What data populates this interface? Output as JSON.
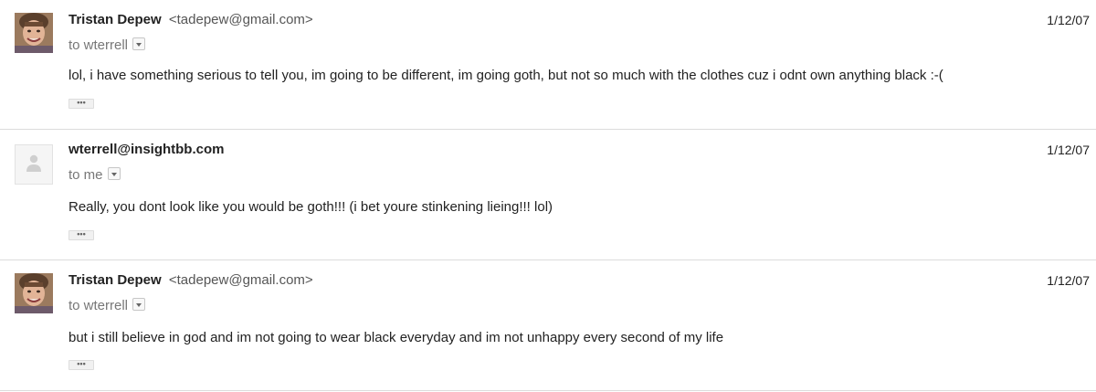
{
  "messages": [
    {
      "sender_name": "Tristan Depew",
      "sender_email": "<tadepew@gmail.com>",
      "recipient": "to wterrell",
      "date": "1/12/07",
      "body": "lol, i have something serious to tell you, im going to be different, im going goth, but not so much with the clothes cuz i odnt own anything black :-(",
      "trimmed_label": "•••",
      "avatar": "profile-photo"
    },
    {
      "sender_name": "wterrell@insightbb.com",
      "sender_email": "",
      "recipient": "to me",
      "date": "1/12/07",
      "body": "Really, you dont look like you would be goth!!! (i bet youre stinkening lieing!!! lol)",
      "trimmed_label": "•••",
      "avatar": "default-person-icon"
    },
    {
      "sender_name": "Tristan Depew",
      "sender_email": "<tadepew@gmail.com>",
      "recipient": "to wterrell",
      "date": "1/12/07",
      "body": "but i still believe in god and im not going to wear black everyday and im not unhappy every second of my life",
      "trimmed_label": "•••",
      "avatar": "profile-photo"
    }
  ],
  "colors": {
    "sender_name": "#222222",
    "secondary_text": "#777777",
    "divider": "#dcdcdc"
  }
}
